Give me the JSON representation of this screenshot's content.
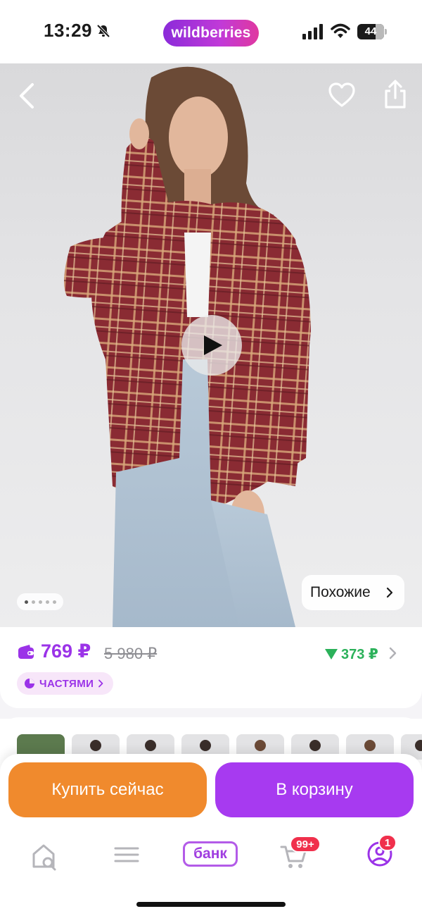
{
  "status_bar": {
    "time": "13:29",
    "brand": "wildberries",
    "battery": "44"
  },
  "product": {
    "similar_label": "Похожие",
    "gallery_total_dots": 5,
    "gallery_active_dot": 1
  },
  "price": {
    "current": "769 ₽",
    "old": "5 980 ₽",
    "discount": "373 ₽",
    "installments_label": "ЧАСТЯМИ"
  },
  "actions": {
    "buy_now": "Купить сейчас",
    "to_cart": "В корзину"
  },
  "tab_bar": {
    "bank_label": "банк",
    "cart_badge": "99+",
    "profile_badge": "1"
  },
  "icons": {
    "back": "chevron-left-icon",
    "favorite": "heart-icon",
    "share": "share-icon",
    "play": "play-icon",
    "wallet": "wallet-icon",
    "home": "home-search-icon",
    "catalog": "menu-icon",
    "cart": "cart-icon",
    "profile": "profile-icon"
  },
  "colors": {
    "brand_purple": "#a73af0",
    "buy_orange": "#f08a2d",
    "discount_green": "#2bb15a",
    "badge_red": "#f0304c",
    "price_purple": "#9b33e8"
  }
}
